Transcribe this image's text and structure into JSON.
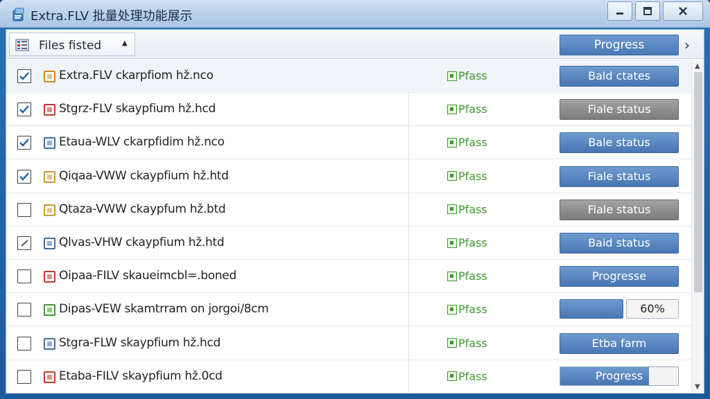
{
  "window": {
    "title": "Extra.FLV 批量处理功能展示"
  },
  "header": {
    "files_label": "Files fisted",
    "progress_label": "Progress"
  },
  "rows": [
    {
      "checked": true,
      "icon_color": "#d08a1a",
      "icon": "file-icon",
      "name": "Extra.FLV ckarpfiom hž.nco",
      "status": "Pfass",
      "action_type": "button",
      "action_style": "blue",
      "action_label": "Bald ctates",
      "selected": true
    },
    {
      "checked": true,
      "icon_color": "#c0392b",
      "icon": "file-icon",
      "name": "Stgrz-FLV skaypfium hž.hcd",
      "status": "Pfass",
      "action_type": "button",
      "action_style": "gray",
      "action_label": "Fiale status"
    },
    {
      "checked": true,
      "icon_color": "#3a6ea5",
      "icon": "file-icon",
      "name": "Etaua-WLV ckarpfidim hž.nco",
      "status": "Pfass",
      "action_type": "button",
      "action_style": "blue",
      "action_label": "Bale status"
    },
    {
      "checked": true,
      "icon_color": "#c79a2a",
      "icon": "file-icon",
      "name": "Qiqaa-VWW ckaypfium hž.htd",
      "status": "Pfass",
      "action_type": "button",
      "action_style": "blue",
      "action_label": "Fiale status"
    },
    {
      "checked": false,
      "icon_color": "#c99a2a",
      "icon": "file-icon",
      "name": "Qtaza-VWW ckaypfum hž.btd",
      "status": "Pfass",
      "action_type": "button",
      "action_style": "gray",
      "action_label": "Fiale status"
    },
    {
      "checked": "partial",
      "icon_color": "#3a6ea5",
      "icon": "file-icon",
      "name": "Qlvas-VHW ckaypfium hž.htd",
      "status": "Pfass",
      "action_type": "button",
      "action_style": "blue",
      "action_label": "Baid status"
    },
    {
      "checked": false,
      "icon_color": "#c0392b",
      "icon": "file-icon",
      "name": "Oipaa-FILV skaueimcbl=.boned",
      "status": "Pfass",
      "action_type": "button",
      "action_style": "blue",
      "action_label": "Progresse"
    },
    {
      "checked": false,
      "icon_color": "#3c9a2c",
      "icon": "file-icon",
      "name": "Dipas-VEW skamtrram on jorgoi/8cm",
      "status": "Pfass",
      "action_type": "split",
      "progress": 0.6,
      "action_label": "60%"
    },
    {
      "checked": false,
      "icon_color": "#3a6ea5",
      "icon": "file-icon",
      "name": "Stgra-FLW skaypfium hž.hcd",
      "status": "Pfass",
      "action_type": "button",
      "action_style": "blue",
      "action_label": "Etba farm"
    },
    {
      "checked": false,
      "icon_color": "#c0392b",
      "icon": "file-icon",
      "name": "Etaba-FILV skaypfium hž.0cd",
      "status": "Pfass",
      "action_type": "progress",
      "progress": 0.75,
      "action_label": "Progress"
    }
  ]
}
